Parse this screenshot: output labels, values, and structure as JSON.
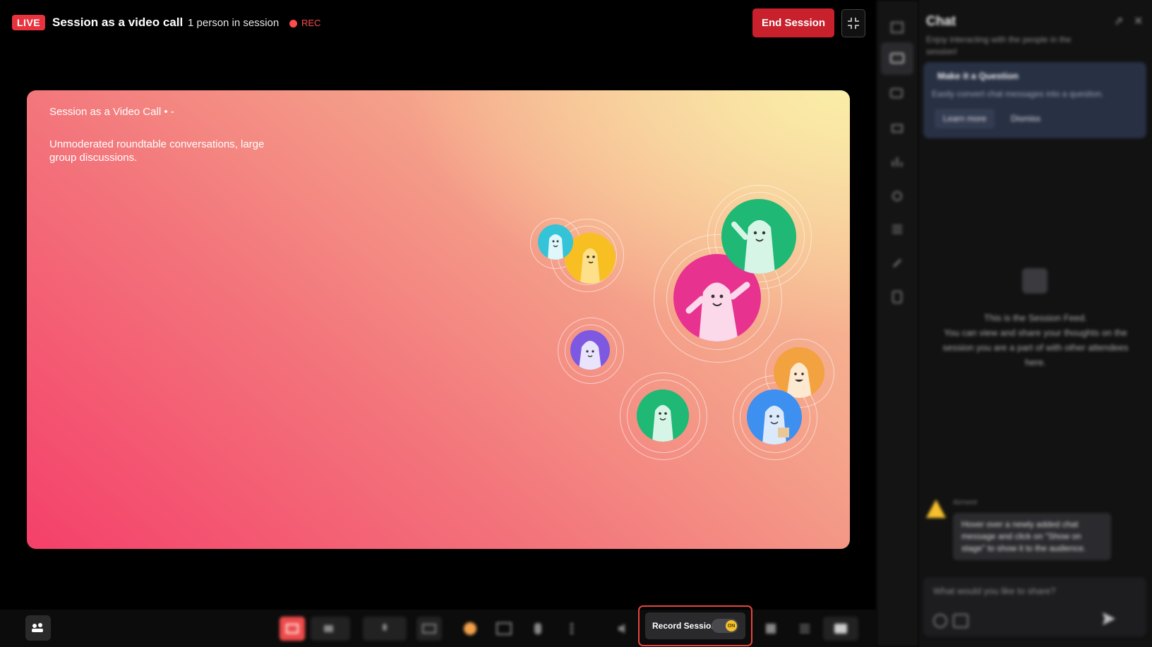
{
  "header": {
    "live_badge": "LIVE",
    "title": "Session as a video call",
    "people_count": "1 person in session",
    "rec_label": "REC",
    "end_button": "End Session"
  },
  "stage": {
    "title": "Session as a Video Call • -",
    "description": "Unmoderated roundtable conversations, large group discussions."
  },
  "chat": {
    "title": "Chat",
    "subtitle": "Enjoy interacting with the people in the session!",
    "promo_title": "Make it a Question",
    "promo_text": "Easily convert chat messages into a question.",
    "promo_learn": "Learn more",
    "promo_dismiss": "Dismiss",
    "feed_line1": "This is the Session Feed.",
    "feed_line2": "You can view and share your thoughts on the session you are a part of with other attendees here.",
    "message_sender": "Airmeet",
    "message_text": "Hover over a newly added chat message and click on \"Show on stage\" to show it to the audience.",
    "composer_placeholder": "What would you like to share?"
  },
  "toolbar": {
    "record_label": "Record Session",
    "record_toggle": "ON"
  },
  "colors": {
    "live_red": "#e8333f",
    "end_button": "#c8202c",
    "highlight": "#e8453a",
    "toggle_on": "#f6c02c"
  }
}
